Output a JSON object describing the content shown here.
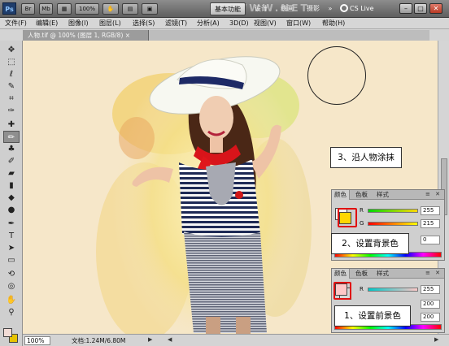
{
  "app": {
    "logo": "Ps",
    "bridge_btn": "Br",
    "mini_btn": "Mb",
    "zoom": "100%",
    "workspaces": [
      "基本功能",
      "设计",
      "绘画",
      "摄影"
    ],
    "active_workspace": "基本功能",
    "more": "»",
    "cs_live": "CS Live",
    "watermark": "WWW.NET"
  },
  "menu": [
    "文件(F)",
    "编辑(E)",
    "图像(I)",
    "图层(L)",
    "选择(S)",
    "滤镜(T)",
    "分析(A)",
    "3D(D)",
    "视图(V)",
    "窗口(W)",
    "帮助(H)"
  ],
  "document": {
    "tab_label": "人物.tif @ 100% (图层 1, RGB/8) ×"
  },
  "tools": [
    {
      "name": "move-tool-icon",
      "glyph": "✥"
    },
    {
      "name": "marquee-tool-icon",
      "glyph": "⬚"
    },
    {
      "name": "lasso-tool-icon",
      "glyph": "ℓ"
    },
    {
      "name": "quick-select-tool-icon",
      "glyph": "✎"
    },
    {
      "name": "crop-tool-icon",
      "glyph": "⌗"
    },
    {
      "name": "eyedropper-tool-icon",
      "glyph": "✑"
    },
    {
      "name": "healing-tool-icon",
      "glyph": "✚"
    },
    {
      "name": "brush-tool-icon",
      "glyph": "🖌"
    },
    {
      "name": "clone-stamp-tool-icon",
      "glyph": "♣"
    },
    {
      "name": "history-brush-tool-icon",
      "glyph": "✐"
    },
    {
      "name": "eraser-tool-icon",
      "glyph": "▰"
    },
    {
      "name": "gradient-tool-icon",
      "glyph": "▮"
    },
    {
      "name": "blur-tool-icon",
      "glyph": "◆"
    },
    {
      "name": "dodge-tool-icon",
      "glyph": "●"
    },
    {
      "name": "pen-tool-icon",
      "glyph": "✒"
    },
    {
      "name": "type-tool-icon",
      "glyph": "T"
    },
    {
      "name": "path-select-tool-icon",
      "glyph": "➤"
    },
    {
      "name": "shape-tool-icon",
      "glyph": "▭"
    },
    {
      "name": "3d-rotate-tool-icon",
      "glyph": "⟲"
    },
    {
      "name": "3d-orbit-tool-icon",
      "glyph": "◎"
    },
    {
      "name": "hand-tool-icon",
      "glyph": "✋"
    },
    {
      "name": "zoom-tool-icon",
      "glyph": "🔍"
    }
  ],
  "status": {
    "zoom": "100%",
    "doc_info": "文档:1.24M/6.80M",
    "arrow": "▶"
  },
  "color_panel_bg": {
    "tabs": [
      "颜色",
      "色板",
      "样式"
    ],
    "active_tab": "颜色",
    "channels": [
      {
        "label": "R",
        "value": "255"
      },
      {
        "label": "G",
        "value": "215"
      },
      {
        "label": "B",
        "value": "0"
      }
    ],
    "fg_swatch": "#f2f2f2",
    "bg_swatch": "#ffd700"
  },
  "color_panel_fg": {
    "tabs": [
      "颜色",
      "色板",
      "样式"
    ],
    "active_tab": "颜色",
    "channels": [
      {
        "label": "R",
        "value": "255"
      },
      {
        "label": "G",
        "value": "200"
      },
      {
        "label": "B",
        "value": "200"
      }
    ],
    "fg_swatch": "#ffc8c8",
    "bg_swatch": "#d8d8d8"
  },
  "callouts": {
    "step3": "3、沿人物涂抹",
    "step2": "2、设置背景色",
    "step1": "1、设置前景色"
  },
  "colors": {
    "canvas_bg": "#f6e7c9",
    "highlight_ring": "#e01010",
    "active_workspace_bg": "#dcdcdc"
  }
}
